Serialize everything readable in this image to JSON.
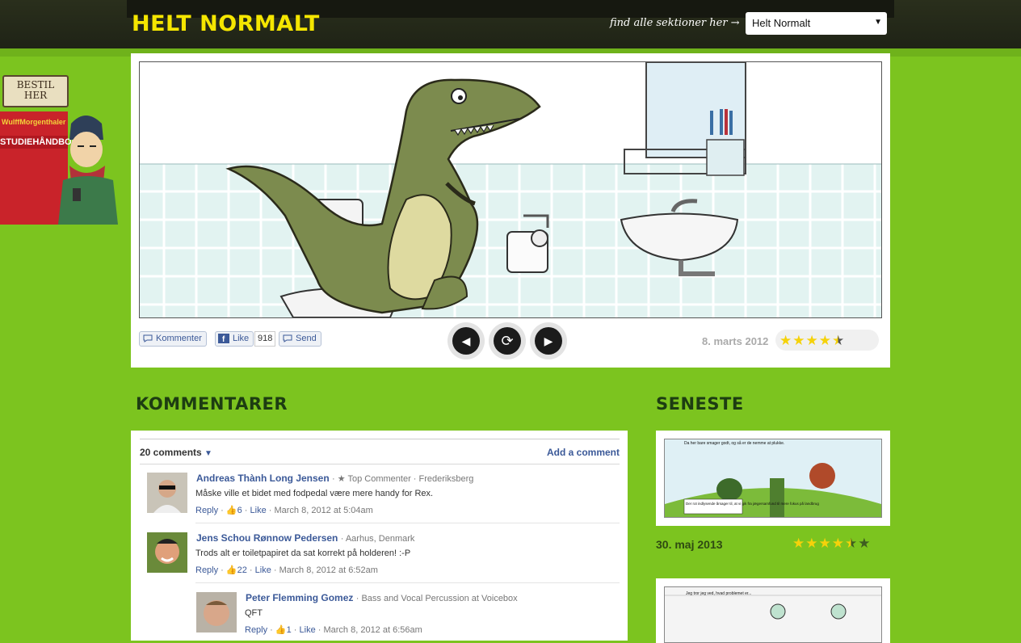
{
  "header": {
    "logo": "HELT NORMALT",
    "find_sections": "find alle sektioner her →",
    "section_select": "Helt Normalt"
  },
  "ad": {
    "sign": "BESTIL HER",
    "brand": "WulffMorgenthaler",
    "book_title": "STUDIEHÅNDBOGEN"
  },
  "comic": {
    "actions": {
      "comment": "Kommenter",
      "like": "Like",
      "like_count": "918",
      "send": "Send"
    },
    "date": "8. marts 2012",
    "rating": 4.5
  },
  "comments_section": {
    "heading": "KOMMENTARER",
    "count": "20 comments",
    "add_comment": "Add a comment",
    "items": [
      {
        "author": "Andreas Thành Long Jensen",
        "meta": "· ★ Top Commenter · Frederiksberg",
        "text": "Måske ville et bidet med fodpedal være mere handy for Rex.",
        "reply": "Reply",
        "likes": "6",
        "like": "Like",
        "time": "· March 8, 2012 at 5:04am"
      },
      {
        "author": "Jens Schou Rønnow Pedersen",
        "meta": "· Aarhus, Denmark",
        "text": "Trods alt er toiletpapiret da sat korrekt på holderen! :-P",
        "reply": "Reply",
        "likes": "22",
        "like": "Like",
        "time": "· March 8, 2012 at 6:52am"
      },
      {
        "author": "Peter Flemming Gomez",
        "meta": "· Bass and Vocal Percussion at Voicebox",
        "text": "QFT",
        "reply": "Reply",
        "likes": "1",
        "like": "Like",
        "time": "· March 8, 2012 at 6:56am"
      }
    ]
  },
  "latest": {
    "heading": "SENESTE",
    "items": [
      {
        "caption_top": "Da her bare smager godt, og så er de nemme at plukke.",
        "caption_bottom": "Der rot indlysende årsager til, at vi gik fra jægersamfund til mere fokus på landbrug",
        "date": "30. maj 2013",
        "rating": 4.5
      },
      {
        "caption_top": "Jeg tror jeg ved, hvad problemet er..."
      }
    ]
  }
}
